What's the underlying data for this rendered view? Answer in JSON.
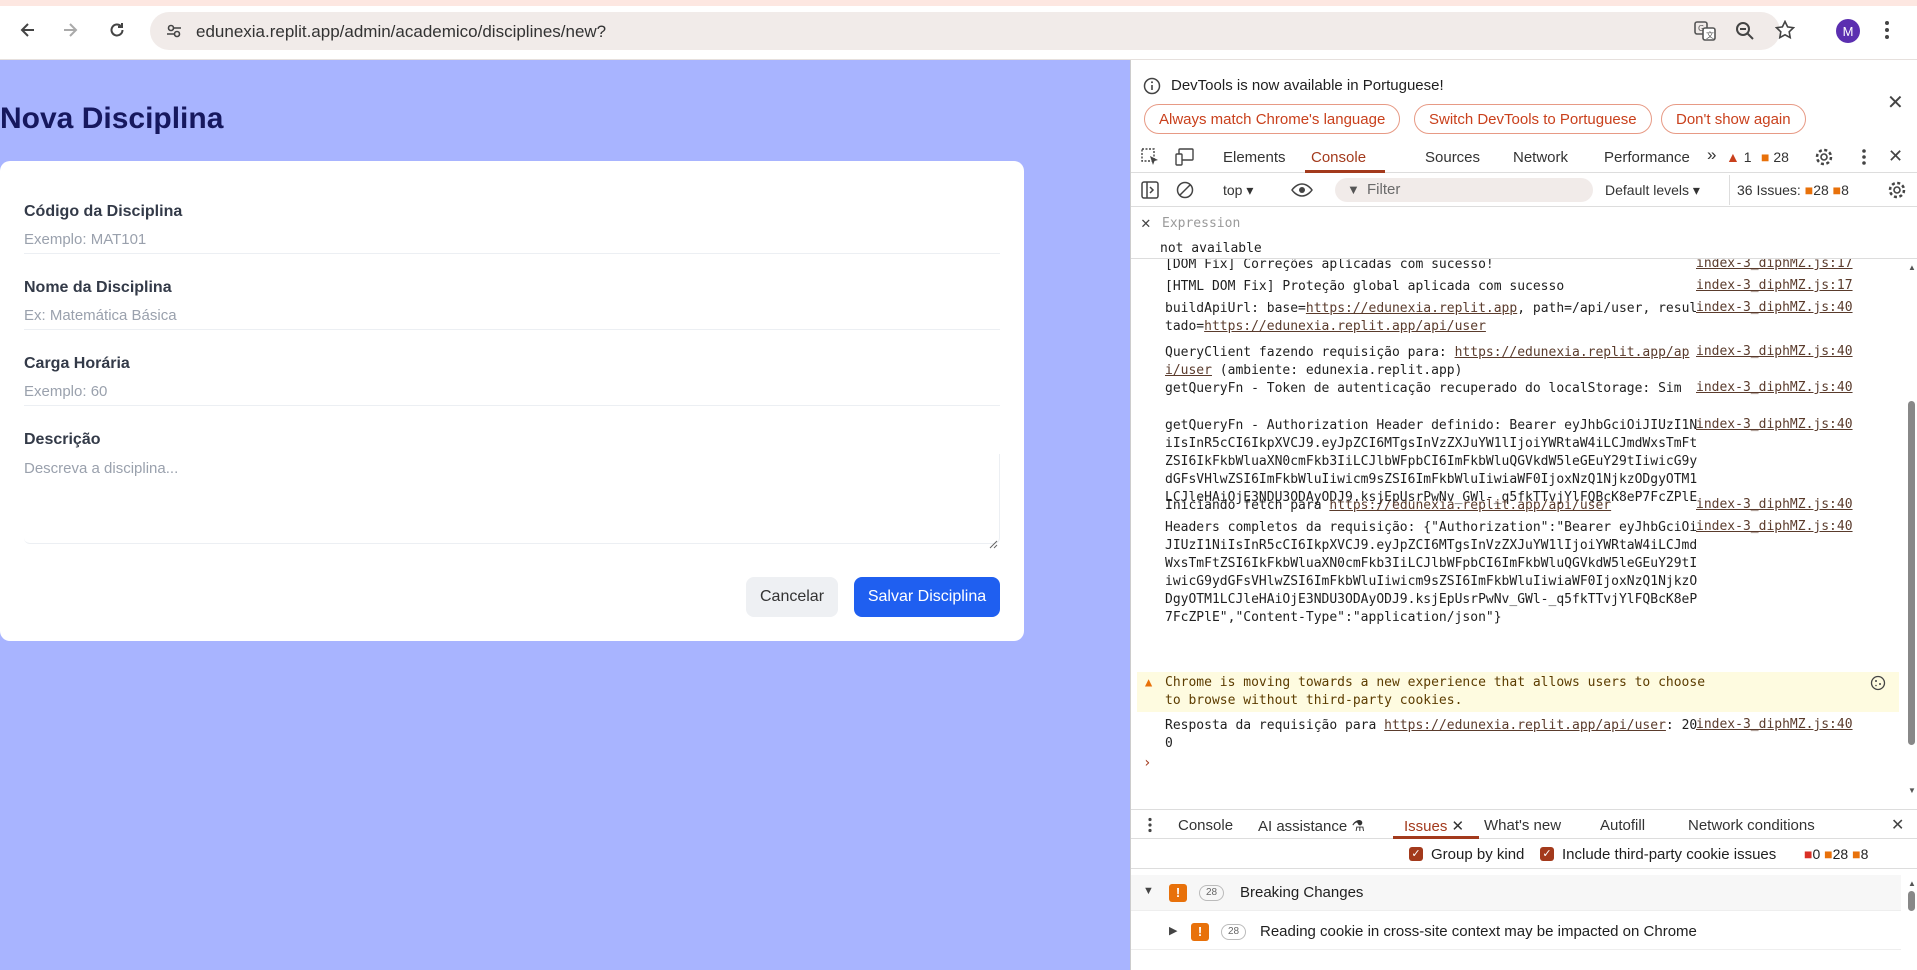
{
  "browser": {
    "url": "edunexia.replit.app/admin/academico/disciplines/new?",
    "avatar_letter": "M"
  },
  "page": {
    "title": "Nova Disciplina",
    "fields": [
      {
        "label": "Código da Disciplina",
        "placeholder": "Exemplo: MAT101"
      },
      {
        "label": "Nome da Disciplina",
        "placeholder": "Ex: Matemática Básica"
      },
      {
        "label": "Carga Horária",
        "placeholder": "Exemplo: 60"
      },
      {
        "label": "Descrição",
        "placeholder": "Descreva a disciplina..."
      }
    ],
    "cancel_label": "Cancelar",
    "save_label": "Salvar Disciplina"
  },
  "devtools": {
    "banner": {
      "text": "DevTools is now available in Portuguese!",
      "buttons": [
        "Always match Chrome's language",
        "Switch DevTools to Portuguese",
        "Don't show again"
      ]
    },
    "tabs": [
      "Elements",
      "Console",
      "Sources",
      "Network",
      "Performance"
    ],
    "active_tab": "Console",
    "warn_count": "1",
    "issue_count": "28",
    "toolbar": {
      "context": "top",
      "filter_placeholder": "Filter",
      "levels": "Default levels",
      "issues_label": "36 Issues:",
      "issues_a": "28",
      "issues_b": "8"
    },
    "expression": {
      "placeholder": "Expression",
      "value": "not available"
    },
    "logs": [
      {
        "text": "[DOM Fix] Correções aplicadas com sucesso!",
        "source": "index-3_diphMZ.js:17"
      },
      {
        "text": "[HTML DOM Fix] Proteção global aplicada com sucesso",
        "source": "index-3_diphMZ.js:17"
      },
      {
        "pre": "buildApiUrl: base=",
        "link1": "https://edunexia.replit.app",
        "mid": ", path=/api/user, resultado=",
        "link2": "https://edunexia.replit.app/api/user",
        "source": "index-3_diphMZ.js:40"
      },
      {
        "pre": "QueryClient fazendo requisição para: ",
        "link1": "https://edunexia.replit.app/api/user",
        "post": " (ambiente: edunexia.replit.app)",
        "source": "index-3_diphMZ.js:40"
      },
      {
        "text": "getQueryFn - Token de autenticação recuperado do localStorage: Sim",
        "source": "index-3_diphMZ.js:40"
      },
      {
        "text": "getQueryFn - Authorization Header definido: Bearer eyJhbGciOiJIUzI1NiIsInR5cCI6IkpXVCJ9.eyJpZCI6MTgsInVzZXJuYW1lIjoiYWRtaW4iLCJmdWxsTmFtZSI6IkFkbWluaXN0cmFkb3IiLCJlbWFpbCI6ImFkbWluQGVkdW5leGEuY29tIiwicG9ydGFsVHlwZSI6ImFkbWluIiwicm9sZSI6ImFkbWluIiwiaWF0IjoxNzQ1NjkzODgyOTM1LCJleHAiOjE3NDU3ODAyODJ9.ksjEpUsrPwNv_GWl-_q5fkTTvjYlFQBcK8eP7FcZPlE",
        "source": "index-3_diphMZ.js:40"
      },
      {
        "pre": "Iniciando fetch para ",
        "link1": "https://edunexia.replit.app/api/user",
        "source": "index-3_diphMZ.js:40"
      },
      {
        "text": "Headers completos da requisição: {\"Authorization\":\"Bearer eyJhbGciOiJIUzI1NiIsInR5cCI6IkpXVCJ9.eyJpZCI6MTgsInVzZXJuYW1lIjoiYWRtaW4iLCJmdWxsTmFtZSI6IkFkbWluaXN0cmFkb3IiLCJlbWFpbCI6ImFkbWluQGVkdW5leGEuY29tIiwicG9ydGFsVHlwZSI6ImFkbWluIiwicm9sZSI6ImFkbWluIiwiaWF0IjoxNzQ1NjkzODgyOTM1LCJleHAiOjE3NDU3ODAyODJ9.ksjEpUsrPwNv_GWl-_q5fkTTvjYlFQBcK8eP7FcZPlE\",\"Content-Type\":\"application/json\"}",
        "source": "index-3_diphMZ.js:40"
      },
      {
        "text": "Chrome is moving towards a new experience that allows users to choose to browse without third-party cookies.",
        "source": ""
      },
      {
        "pre": "Resposta da requisição para ",
        "link1": "https://edunexia.replit.app/api/user",
        "post": ": 200",
        "source": "index-3_diphMZ.js:40"
      }
    ],
    "drawer": {
      "tabs": [
        "Console",
        "AI assistance",
        "Issues",
        "What's new",
        "Autofill",
        "Network conditions"
      ],
      "active": "Issues",
      "group_by_kind": "Group by kind",
      "include_third_party": "Include third-party cookie issues",
      "counts": [
        "0",
        "28",
        "8"
      ],
      "issues": [
        {
          "count": "28",
          "title": "Breaking Changes"
        },
        {
          "count": "28",
          "title": "Reading cookie in cross-site context may be impacted on Chrome"
        }
      ]
    }
  },
  "colors": {
    "page_bg": "#a8b4ff",
    "title": "#16185e",
    "primary": "#1f5ff0",
    "devtools_accent": "#a33a1c"
  }
}
